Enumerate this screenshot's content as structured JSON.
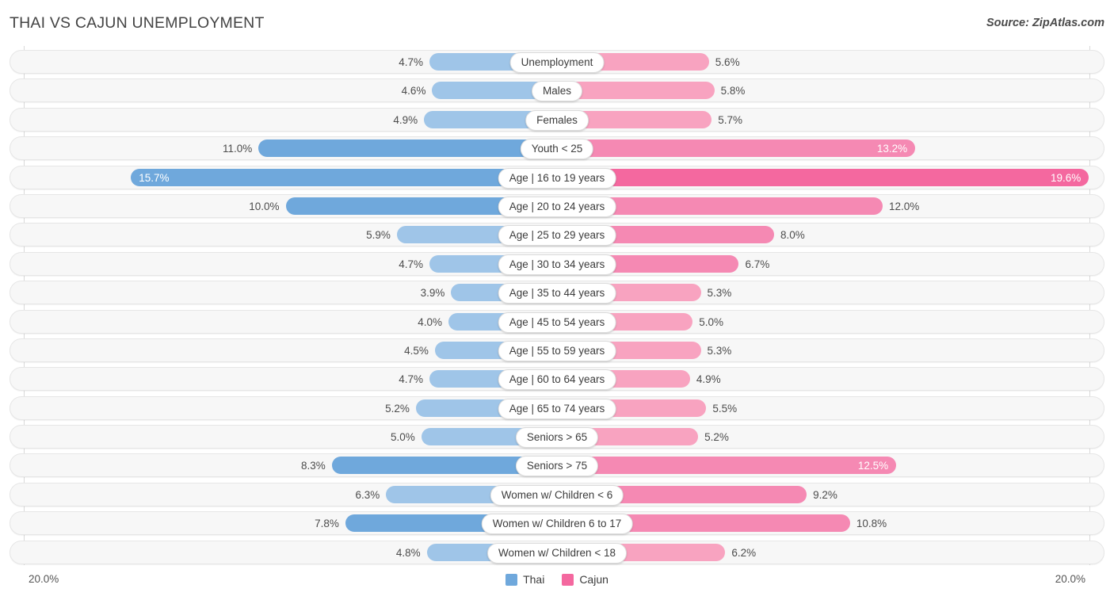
{
  "header": {
    "title": "THAI VS CAJUN UNEMPLOYMENT",
    "source": "Source: ZipAtlas.com"
  },
  "axis": {
    "left_tick": "20.0%",
    "right_tick": "20.0%",
    "max": 20.0
  },
  "legend": {
    "items": [
      {
        "label": "Thai",
        "color": "#6fa8dc"
      },
      {
        "label": "Cajun",
        "color": "#f4689f"
      }
    ]
  },
  "colors": {
    "thai_light": "#9fc5e8",
    "thai_dark": "#6fa8dc",
    "cajun_light": "#f8a3c0",
    "cajun_mid": "#f589b3",
    "cajun_dark": "#f4689f",
    "row_bg": "#f7f7f7",
    "row_border": "#e6e6e6"
  },
  "chart_data": {
    "type": "bar",
    "orientation": "horizontal-diverging",
    "title": "THAI VS CAJUN UNEMPLOYMENT",
    "xlabel": "",
    "ylabel": "",
    "xlim": [
      20.0,
      20.0
    ],
    "grid": false,
    "legend_position": "bottom-center",
    "categories": [
      "Unemployment",
      "Males",
      "Females",
      "Youth < 25",
      "Age | 16 to 19 years",
      "Age | 20 to 24 years",
      "Age | 25 to 29 years",
      "Age | 30 to 34 years",
      "Age | 35 to 44 years",
      "Age | 45 to 54 years",
      "Age | 55 to 59 years",
      "Age | 60 to 64 years",
      "Age | 65 to 74 years",
      "Seniors > 65",
      "Seniors > 75",
      "Women w/ Children < 6",
      "Women w/ Children 6 to 17",
      "Women w/ Children < 18"
    ],
    "series": [
      {
        "name": "Thai",
        "color": "#6fa8dc",
        "values": [
          4.7,
          4.6,
          4.9,
          11.0,
          15.7,
          10.0,
          5.9,
          4.7,
          3.9,
          4.0,
          4.5,
          4.7,
          5.2,
          5.0,
          8.3,
          6.3,
          7.8,
          4.8
        ]
      },
      {
        "name": "Cajun",
        "color": "#f4689f",
        "values": [
          5.6,
          5.8,
          5.7,
          13.2,
          19.6,
          12.0,
          8.0,
          6.7,
          5.3,
          5.0,
          5.3,
          4.9,
          5.5,
          5.2,
          12.5,
          9.2,
          10.8,
          6.2
        ]
      }
    ]
  },
  "rows": [
    {
      "label": "Unemployment",
      "left": "4.7%",
      "right": "5.6%",
      "lv": 4.7,
      "rv": 5.6,
      "l_inside": false,
      "r_inside": false,
      "l_tone": "light",
      "r_tone": "light"
    },
    {
      "label": "Males",
      "left": "4.6%",
      "right": "5.8%",
      "lv": 4.6,
      "rv": 5.8,
      "l_inside": false,
      "r_inside": false,
      "l_tone": "light",
      "r_tone": "light"
    },
    {
      "label": "Females",
      "left": "4.9%",
      "right": "5.7%",
      "lv": 4.9,
      "rv": 5.7,
      "l_inside": false,
      "r_inside": false,
      "l_tone": "light",
      "r_tone": "light"
    },
    {
      "label": "Youth < 25",
      "left": "11.0%",
      "right": "13.2%",
      "lv": 11.0,
      "rv": 13.2,
      "l_inside": false,
      "r_inside": true,
      "l_tone": "dark",
      "r_tone": "mid"
    },
    {
      "label": "Age | 16 to 19 years",
      "left": "15.7%",
      "right": "19.6%",
      "lv": 15.7,
      "rv": 19.6,
      "l_inside": true,
      "r_inside": true,
      "l_tone": "dark",
      "r_tone": "dark"
    },
    {
      "label": "Age | 20 to 24 years",
      "left": "10.0%",
      "right": "12.0%",
      "lv": 10.0,
      "rv": 12.0,
      "l_inside": false,
      "r_inside": false,
      "l_tone": "dark",
      "r_tone": "mid"
    },
    {
      "label": "Age | 25 to 29 years",
      "left": "5.9%",
      "right": "8.0%",
      "lv": 5.9,
      "rv": 8.0,
      "l_inside": false,
      "r_inside": false,
      "l_tone": "light",
      "r_tone": "mid"
    },
    {
      "label": "Age | 30 to 34 years",
      "left": "4.7%",
      "right": "6.7%",
      "lv": 4.7,
      "rv": 6.7,
      "l_inside": false,
      "r_inside": false,
      "l_tone": "light",
      "r_tone": "mid"
    },
    {
      "label": "Age | 35 to 44 years",
      "left": "3.9%",
      "right": "5.3%",
      "lv": 3.9,
      "rv": 5.3,
      "l_inside": false,
      "r_inside": false,
      "l_tone": "light",
      "r_tone": "light"
    },
    {
      "label": "Age | 45 to 54 years",
      "left": "4.0%",
      "right": "5.0%",
      "lv": 4.0,
      "rv": 5.0,
      "l_inside": false,
      "r_inside": false,
      "l_tone": "light",
      "r_tone": "light"
    },
    {
      "label": "Age | 55 to 59 years",
      "left": "4.5%",
      "right": "5.3%",
      "lv": 4.5,
      "rv": 5.3,
      "l_inside": false,
      "r_inside": false,
      "l_tone": "light",
      "r_tone": "light"
    },
    {
      "label": "Age | 60 to 64 years",
      "left": "4.7%",
      "right": "4.9%",
      "lv": 4.7,
      "rv": 4.9,
      "l_inside": false,
      "r_inside": false,
      "l_tone": "light",
      "r_tone": "light"
    },
    {
      "label": "Age | 65 to 74 years",
      "left": "5.2%",
      "right": "5.5%",
      "lv": 5.2,
      "rv": 5.5,
      "l_inside": false,
      "r_inside": false,
      "l_tone": "light",
      "r_tone": "light"
    },
    {
      "label": "Seniors > 65",
      "left": "5.0%",
      "right": "5.2%",
      "lv": 5.0,
      "rv": 5.2,
      "l_inside": false,
      "r_inside": false,
      "l_tone": "light",
      "r_tone": "light"
    },
    {
      "label": "Seniors > 75",
      "left": "8.3%",
      "right": "12.5%",
      "lv": 8.3,
      "rv": 12.5,
      "l_inside": false,
      "r_inside": true,
      "l_tone": "dark",
      "r_tone": "mid"
    },
    {
      "label": "Women w/ Children < 6",
      "left": "6.3%",
      "right": "9.2%",
      "lv": 6.3,
      "rv": 9.2,
      "l_inside": false,
      "r_inside": false,
      "l_tone": "light",
      "r_tone": "mid"
    },
    {
      "label": "Women w/ Children 6 to 17",
      "left": "7.8%",
      "right": "10.8%",
      "lv": 7.8,
      "rv": 10.8,
      "l_inside": false,
      "r_inside": false,
      "l_tone": "dark",
      "r_tone": "mid"
    },
    {
      "label": "Women w/ Children < 18",
      "left": "4.8%",
      "right": "6.2%",
      "lv": 4.8,
      "rv": 6.2,
      "l_inside": false,
      "r_inside": false,
      "l_tone": "light",
      "r_tone": "light"
    }
  ]
}
